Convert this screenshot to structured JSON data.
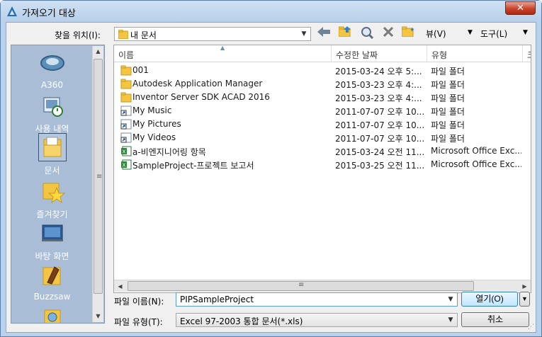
{
  "window": {
    "title": "가져오기 대상",
    "close_label": "✕"
  },
  "toolbar": {
    "look_in_label": "찾을 위치(I):",
    "look_in_value": "내 문서",
    "views_label": "뷰(V)",
    "tools_label": "도구(L)"
  },
  "places": [
    {
      "label": "A360",
      "icon": "a360-icon"
    },
    {
      "label": "사용 내역",
      "icon": "history-icon"
    },
    {
      "label": "문서",
      "icon": "documents-folder-icon"
    },
    {
      "label": "즐겨찾기",
      "icon": "favorites-icon"
    },
    {
      "label": "바탕 화면",
      "icon": "desktop-icon"
    },
    {
      "label": "Buzzsaw",
      "icon": "buzzsaw-icon"
    }
  ],
  "columns": [
    "이름",
    "수정한 날짜",
    "유형",
    "크"
  ],
  "files": [
    {
      "name": "001",
      "date": "2015-03-24 오후 5:...",
      "type": "파일 폴더",
      "icon": "folder"
    },
    {
      "name": "Autodesk Application Manager",
      "date": "2015-03-23 오후 4:...",
      "type": "파일 폴더",
      "icon": "folder"
    },
    {
      "name": "Inventor Server SDK ACAD 2016",
      "date": "2015-03-23 오후 4:...",
      "type": "파일 폴더",
      "icon": "folder"
    },
    {
      "name": "My Music",
      "date": "2011-07-07 오후 10...",
      "type": "파일 폴더",
      "icon": "shortcut"
    },
    {
      "name": "My Pictures",
      "date": "2011-07-07 오후 10...",
      "type": "파일 폴더",
      "icon": "shortcut"
    },
    {
      "name": "My Videos",
      "date": "2011-07-07 오후 10...",
      "type": "파일 폴더",
      "icon": "shortcut"
    },
    {
      "name": "a-비엔지니어링 항목",
      "date": "2015-03-24 오전 11...",
      "type": "Microsoft Office Exc...",
      "icon": "excel"
    },
    {
      "name": "SampleProject-프로젝트 보고서",
      "date": "2015-03-25 오전 11...",
      "type": "Microsoft Office Exc...",
      "icon": "excel"
    }
  ],
  "bottom": {
    "filename_label": "파일 이름(N):",
    "filename_value": "PIPSampleProject",
    "filetype_label": "파일 유형(T):",
    "filetype_value": "Excel 97-2003 통합 문서(*.xls)",
    "open_label": "열기(O)",
    "cancel_label": "취소"
  },
  "colors": {
    "places_bg": "#a9bed6",
    "title_bg": "#b9d1ea",
    "folder": "#f4c542",
    "close": "#c7432a"
  }
}
